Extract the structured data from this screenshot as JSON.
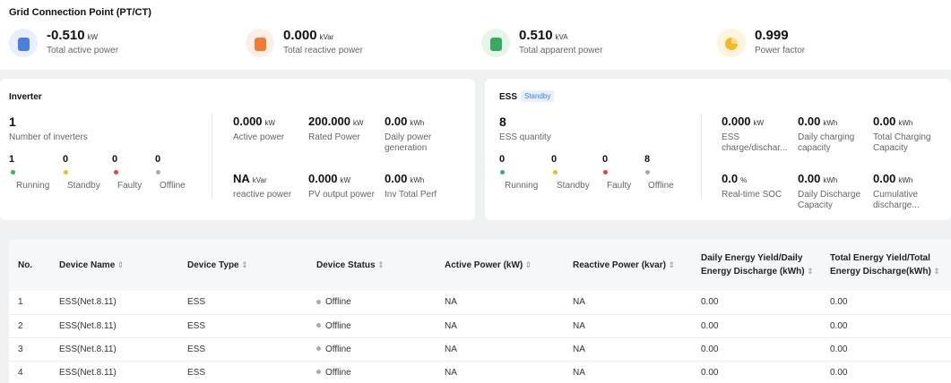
{
  "gcp": {
    "title": "Grid Connection Point (PT/CT)",
    "metrics": [
      {
        "value": "-0.510",
        "unit": "kW",
        "label": "Total active power",
        "icon": "active-power-icon",
        "color": "#4a7fe0"
      },
      {
        "value": "0.000",
        "unit": "kVar",
        "label": "Total reactive power",
        "icon": "reactive-power-icon",
        "color": "#f07a3a"
      },
      {
        "value": "0.510",
        "unit": "kVA",
        "label": "Total apparent power",
        "icon": "apparent-power-icon",
        "color": "#3aa860"
      },
      {
        "value": "0.999",
        "unit": "",
        "label": "Power factor",
        "icon": "pie-chart-icon",
        "color": "#f5b820"
      }
    ]
  },
  "inverter": {
    "title": "Inverter",
    "count": "1",
    "count_label": "Number of inverters",
    "statuses": [
      {
        "count": "1",
        "label": "Running",
        "color": "#2db55d"
      },
      {
        "count": "0",
        "label": "Standby",
        "color": "#f5b820"
      },
      {
        "count": "0",
        "label": "Faulty",
        "color": "#e8413c"
      },
      {
        "count": "0",
        "label": "Offline",
        "color": "#aaaaaa"
      }
    ],
    "stats": [
      {
        "value": "0.000",
        "unit": "kW",
        "label": "Active power"
      },
      {
        "value": "200.000",
        "unit": "kW",
        "label": "Rated Power"
      },
      {
        "value": "0.00",
        "unit": "kWh",
        "label": "Daily power generation"
      },
      {
        "value": "NA",
        "unit": "kVar",
        "label": "reactive power"
      },
      {
        "value": "0.000",
        "unit": "kW",
        "label": "PV output power"
      },
      {
        "value": "0.00",
        "unit": "kWh",
        "label": "Inv Total Perf"
      }
    ]
  },
  "ess": {
    "title": "ESS",
    "badge": "Standby",
    "count": "8",
    "count_label": "ESS quantity",
    "statuses": [
      {
        "count": "0",
        "label": "Running",
        "color": "#2db55d"
      },
      {
        "count": "0",
        "label": "Standby",
        "color": "#f5b820"
      },
      {
        "count": "0",
        "label": "Faulty",
        "color": "#e8413c"
      },
      {
        "count": "8",
        "label": "Offline",
        "color": "#aaaaaa"
      }
    ],
    "stats": [
      {
        "value": "0.000",
        "unit": "kW",
        "label": "ESS charge/dischar..."
      },
      {
        "value": "0.00",
        "unit": "kWh",
        "label": "Daily charging capacity"
      },
      {
        "value": "0.00",
        "unit": "kWh",
        "label": "Total Charging Capacity"
      },
      {
        "value": "0.0",
        "unit": "%",
        "label": "Real-time SOC"
      },
      {
        "value": "0.00",
        "unit": "kWh",
        "label": "Daily Discharge Capacity"
      },
      {
        "value": "0.00",
        "unit": "kWh",
        "label": "Cumulative discharge..."
      }
    ]
  },
  "table": {
    "sort_icon": "sort-icon",
    "columns": [
      {
        "label": "No.",
        "sortable": false
      },
      {
        "label": "Device Name",
        "sortable": true
      },
      {
        "label": "Device Type",
        "sortable": true
      },
      {
        "label": "Device Status",
        "sortable": true
      },
      {
        "label": "Active Power (kW)",
        "sortable": true
      },
      {
        "label": "Reactive Power (kvar)",
        "sortable": true
      },
      {
        "label": "Daily Energy Yield/Daily Energy Discharge (kWh)",
        "sortable": true
      },
      {
        "label": "Total Energy Yield/Total Energy Discharge(kWh)",
        "sortable": true
      }
    ],
    "rows": [
      [
        "1",
        "ESS(Net.8.11)",
        "ESS",
        "Offline",
        "NA",
        "NA",
        "0.00",
        "0.00"
      ],
      [
        "2",
        "ESS(Net.8.11)",
        "ESS",
        "Offline",
        "NA",
        "NA",
        "0.00",
        "0.00"
      ],
      [
        "3",
        "ESS(Net.8.11)",
        "ESS",
        "Offline",
        "NA",
        "NA",
        "0.00",
        "0.00"
      ],
      [
        "4",
        "ESS(Net.8.11)",
        "ESS",
        "Offline",
        "NA",
        "NA",
        "0.00",
        "0.00"
      ]
    ]
  }
}
